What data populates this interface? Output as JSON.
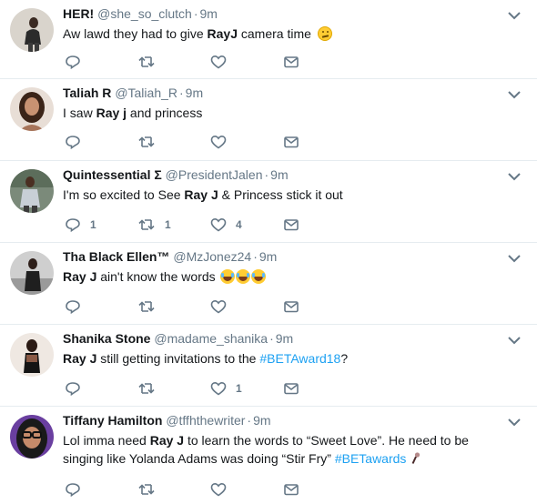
{
  "tweets": [
    {
      "fullname": "HER!",
      "username": "@she_so_clutch",
      "time": "9m",
      "parts": [
        "Aw lawd they had to give ",
        "RayJ",
        " camera time"
      ],
      "emoji": "confused-face",
      "replies": "",
      "retweets": "",
      "likes": ""
    },
    {
      "fullname": "Taliah R",
      "username": "@Taliah_R",
      "time": "9m",
      "parts": [
        "I saw ",
        "Ray j",
        " and princess"
      ],
      "replies": "",
      "retweets": "",
      "likes": ""
    },
    {
      "fullname": "Quintessential Σ",
      "username": "@PresidentJalen",
      "time": "9m",
      "parts": [
        "I'm so excited to See ",
        "Ray J",
        " & Princess stick it out"
      ],
      "replies": "1",
      "retweets": "1",
      "likes": "4"
    },
    {
      "fullname": "Tha Black Ellen™",
      "username": "@MzJonez24",
      "time": "9m",
      "parts": [
        "Ray J",
        " ain't know the words "
      ],
      "emoji": "tears-of-joy x3",
      "replies": "",
      "retweets": "",
      "likes": ""
    },
    {
      "fullname": "Shanika Stone",
      "username": "@madame_shanika",
      "time": "9m",
      "parts": [
        "Ray J",
        " still getting invitations to the ",
        "#BETAward18",
        "?"
      ],
      "replies": "",
      "retweets": "",
      "likes": "1"
    },
    {
      "fullname": "Tiffany Hamilton",
      "username": "@tffhthewriter",
      "time": "9m",
      "parts": [
        "Lol imma need ",
        "Ray J",
        " to learn the words to “Sweet Love”. He need to be singing like Yolanda Adams was doing “Stir Fry” ",
        "#BETawards"
      ],
      "emoji": "microphone",
      "replies": "",
      "retweets": "",
      "likes": ""
    }
  ],
  "colors": {
    "link": "#1da1f2",
    "secondary_text": "#657786",
    "divider": "#e6ecf0"
  },
  "icons": [
    "reply-icon",
    "retweet-icon",
    "like-icon",
    "direct-message-icon",
    "chevron-down-icon"
  ]
}
